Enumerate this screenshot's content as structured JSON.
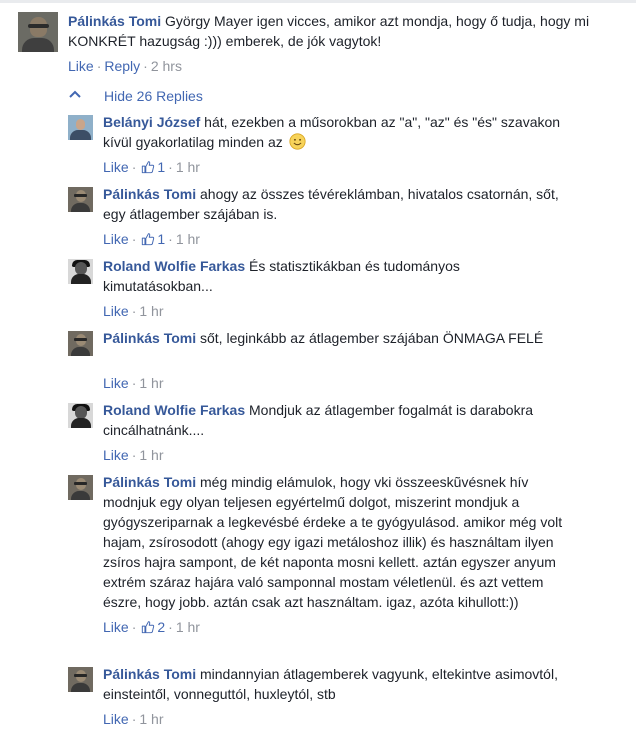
{
  "main_comment": {
    "author": "Pálinkás Tomi",
    "text": "György Mayer igen vicces, amikor azt mondja, hogy ő tudja, hogy mi KONKRÉT hazugság :))) emberek, de jók vagytok!",
    "like_label": "Like",
    "reply_label": "Reply",
    "time": "2 hrs"
  },
  "hide_replies_label": "Hide 26 Replies",
  "replies": [
    {
      "author": "Belányi József",
      "text": "hát, ezekben a műsorokban az \"a\", \"az\" és \"és\" szavakon kívül gyakorlatilag minden az",
      "has_smiley": true,
      "like_label": "Like",
      "like_count": "1",
      "time": "1 hr",
      "avatar": "jozsef"
    },
    {
      "author": "Pálinkás Tomi",
      "text": "ahogy az összes tévéreklámban, hivatalos csatornán, sőt, egy átlagember szájában is.",
      "like_label": "Like",
      "like_count": "1",
      "time": "1 hr",
      "avatar": "tomi"
    },
    {
      "author": "Roland Wolfie Farkas",
      "text": "És statisztikákban és tudományos kimutatásokban...",
      "like_label": "Like",
      "time": "1 hr",
      "avatar": "roland"
    },
    {
      "author": "Pálinkás Tomi",
      "text": "sőt, leginkább az átlagember szájában ÖNMAGA FELÉ",
      "like_label": "Like",
      "time": "1 hr",
      "avatar": "tomi"
    },
    {
      "author": "Roland Wolfie Farkas",
      "text": "Mondjuk az átlagember fogalmát is darabokra cincálhatnánk....",
      "like_label": "Like",
      "time": "1 hr",
      "avatar": "roland"
    },
    {
      "author": "Pálinkás Tomi",
      "text": "még mindig elámulok, hogy vki összeeskũvésnek hív modnjuk egy olyan teljesen egyértelmű dolgot, miszerint mondjuk a gyógyszeriparnak a legkevésbé érdeke a te gyógyulásod. amikor még volt hajam, zsírosodott (ahogy egy igazi metáloshoz illik) és használtam ilyen zsíros hajra sampont, de két naponta mosni kellett. aztán egyszer anyum extrém száraz hajára való samponnal mostam véletlenül. és azt vettem észre, hogy jobb. aztán csak azt használtam. igaz, azóta kihullott:))",
      "like_label": "Like",
      "like_count": "2",
      "time": "1 hr",
      "avatar": "tomi"
    },
    {
      "author": "Pálinkás Tomi",
      "text": "mindannyian átlagemberek vagyunk, eltekintve asimovtól, einsteintől, vonneguttól, huxleytól, stb",
      "like_label": "Like",
      "time": "1 hr",
      "avatar": "tomi"
    }
  ],
  "colors": {
    "author": "#365899",
    "link": "#4267b2",
    "meta": "#90949c",
    "text": "#1d2129"
  },
  "icons": [
    "chevron-up-icon",
    "like-thumb-icon",
    "smiley-emoji-icon"
  ]
}
